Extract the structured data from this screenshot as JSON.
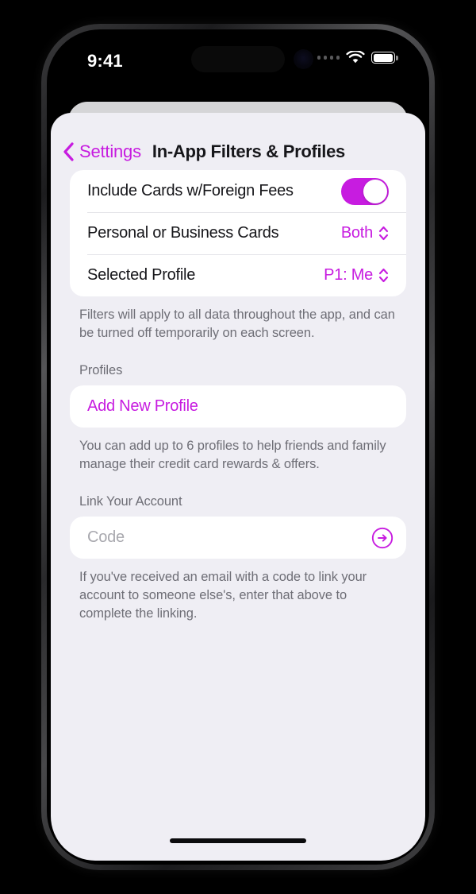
{
  "status_bar": {
    "time": "9:41",
    "cellular_icon": "cellular-dots-icon",
    "wifi_icon": "wifi-icon",
    "battery_icon": "battery-icon",
    "battery_level_pct": 88
  },
  "nav": {
    "back_icon": "chevron-left-icon",
    "back_label": "Settings",
    "title": "In-App Filters & Profiles"
  },
  "filters_group": {
    "rows": [
      {
        "label": "Include Cards w/Foreign Fees",
        "control": "toggle",
        "value": "on"
      },
      {
        "label": "Personal or Business Cards",
        "control": "menu",
        "value": "Both",
        "value_icon": "chevron-up-down-icon"
      },
      {
        "label": "Selected Profile",
        "control": "menu",
        "value": "P1: Me",
        "value_icon": "chevron-up-down-icon"
      }
    ],
    "footnote": "Filters will apply to all data throughout the app, and can be turned off temporarily on each screen."
  },
  "profiles_section": {
    "header": "Profiles",
    "add_label": "Add New Profile",
    "footnote": "You can add up to 6 profiles to help friends and family manage their credit card rewards & offers."
  },
  "link_account_section": {
    "header": "Link Your Account",
    "code_placeholder": "Code",
    "code_value": "",
    "submit_icon": "arrow-right-circle-icon",
    "footnote": "If you've received an email with a code to link your account to someone else's, enter that above to complete the linking."
  },
  "colors": {
    "accent": "#c71ce0",
    "sheet_background": "#efeef4",
    "card_background": "#ffffff",
    "primary_text": "#16161a",
    "secondary_text": "#6e6e76",
    "separator": "#e3e3e8"
  }
}
